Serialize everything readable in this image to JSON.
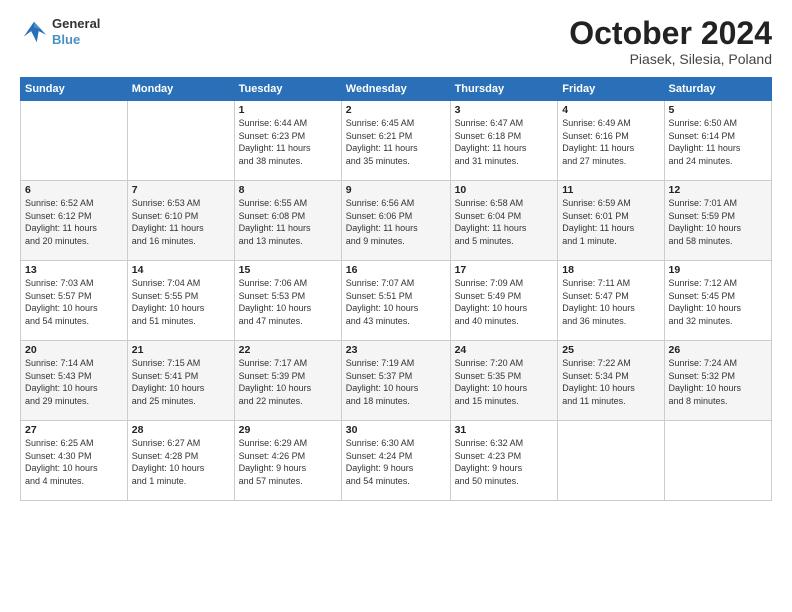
{
  "logo": {
    "line1": "General",
    "line2": "Blue"
  },
  "title": "October 2024",
  "subtitle": "Piasek, Silesia, Poland",
  "headers": [
    "Sunday",
    "Monday",
    "Tuesday",
    "Wednesday",
    "Thursday",
    "Friday",
    "Saturday"
  ],
  "weeks": [
    [
      {
        "day": "",
        "detail": ""
      },
      {
        "day": "",
        "detail": ""
      },
      {
        "day": "1",
        "detail": "Sunrise: 6:44 AM\nSunset: 6:23 PM\nDaylight: 11 hours\nand 38 minutes."
      },
      {
        "day": "2",
        "detail": "Sunrise: 6:45 AM\nSunset: 6:21 PM\nDaylight: 11 hours\nand 35 minutes."
      },
      {
        "day": "3",
        "detail": "Sunrise: 6:47 AM\nSunset: 6:18 PM\nDaylight: 11 hours\nand 31 minutes."
      },
      {
        "day": "4",
        "detail": "Sunrise: 6:49 AM\nSunset: 6:16 PM\nDaylight: 11 hours\nand 27 minutes."
      },
      {
        "day": "5",
        "detail": "Sunrise: 6:50 AM\nSunset: 6:14 PM\nDaylight: 11 hours\nand 24 minutes."
      }
    ],
    [
      {
        "day": "6",
        "detail": "Sunrise: 6:52 AM\nSunset: 6:12 PM\nDaylight: 11 hours\nand 20 minutes."
      },
      {
        "day": "7",
        "detail": "Sunrise: 6:53 AM\nSunset: 6:10 PM\nDaylight: 11 hours\nand 16 minutes."
      },
      {
        "day": "8",
        "detail": "Sunrise: 6:55 AM\nSunset: 6:08 PM\nDaylight: 11 hours\nand 13 minutes."
      },
      {
        "day": "9",
        "detail": "Sunrise: 6:56 AM\nSunset: 6:06 PM\nDaylight: 11 hours\nand 9 minutes."
      },
      {
        "day": "10",
        "detail": "Sunrise: 6:58 AM\nSunset: 6:04 PM\nDaylight: 11 hours\nand 5 minutes."
      },
      {
        "day": "11",
        "detail": "Sunrise: 6:59 AM\nSunset: 6:01 PM\nDaylight: 11 hours\nand 1 minute."
      },
      {
        "day": "12",
        "detail": "Sunrise: 7:01 AM\nSunset: 5:59 PM\nDaylight: 10 hours\nand 58 minutes."
      }
    ],
    [
      {
        "day": "13",
        "detail": "Sunrise: 7:03 AM\nSunset: 5:57 PM\nDaylight: 10 hours\nand 54 minutes."
      },
      {
        "day": "14",
        "detail": "Sunrise: 7:04 AM\nSunset: 5:55 PM\nDaylight: 10 hours\nand 51 minutes."
      },
      {
        "day": "15",
        "detail": "Sunrise: 7:06 AM\nSunset: 5:53 PM\nDaylight: 10 hours\nand 47 minutes."
      },
      {
        "day": "16",
        "detail": "Sunrise: 7:07 AM\nSunset: 5:51 PM\nDaylight: 10 hours\nand 43 minutes."
      },
      {
        "day": "17",
        "detail": "Sunrise: 7:09 AM\nSunset: 5:49 PM\nDaylight: 10 hours\nand 40 minutes."
      },
      {
        "day": "18",
        "detail": "Sunrise: 7:11 AM\nSunset: 5:47 PM\nDaylight: 10 hours\nand 36 minutes."
      },
      {
        "day": "19",
        "detail": "Sunrise: 7:12 AM\nSunset: 5:45 PM\nDaylight: 10 hours\nand 32 minutes."
      }
    ],
    [
      {
        "day": "20",
        "detail": "Sunrise: 7:14 AM\nSunset: 5:43 PM\nDaylight: 10 hours\nand 29 minutes."
      },
      {
        "day": "21",
        "detail": "Sunrise: 7:15 AM\nSunset: 5:41 PM\nDaylight: 10 hours\nand 25 minutes."
      },
      {
        "day": "22",
        "detail": "Sunrise: 7:17 AM\nSunset: 5:39 PM\nDaylight: 10 hours\nand 22 minutes."
      },
      {
        "day": "23",
        "detail": "Sunrise: 7:19 AM\nSunset: 5:37 PM\nDaylight: 10 hours\nand 18 minutes."
      },
      {
        "day": "24",
        "detail": "Sunrise: 7:20 AM\nSunset: 5:35 PM\nDaylight: 10 hours\nand 15 minutes."
      },
      {
        "day": "25",
        "detail": "Sunrise: 7:22 AM\nSunset: 5:34 PM\nDaylight: 10 hours\nand 11 minutes."
      },
      {
        "day": "26",
        "detail": "Sunrise: 7:24 AM\nSunset: 5:32 PM\nDaylight: 10 hours\nand 8 minutes."
      }
    ],
    [
      {
        "day": "27",
        "detail": "Sunrise: 6:25 AM\nSunset: 4:30 PM\nDaylight: 10 hours\nand 4 minutes."
      },
      {
        "day": "28",
        "detail": "Sunrise: 6:27 AM\nSunset: 4:28 PM\nDaylight: 10 hours\nand 1 minute."
      },
      {
        "day": "29",
        "detail": "Sunrise: 6:29 AM\nSunset: 4:26 PM\nDaylight: 9 hours\nand 57 minutes."
      },
      {
        "day": "30",
        "detail": "Sunrise: 6:30 AM\nSunset: 4:24 PM\nDaylight: 9 hours\nand 54 minutes."
      },
      {
        "day": "31",
        "detail": "Sunrise: 6:32 AM\nSunset: 4:23 PM\nDaylight: 9 hours\nand 50 minutes."
      },
      {
        "day": "",
        "detail": ""
      },
      {
        "day": "",
        "detail": ""
      }
    ]
  ]
}
